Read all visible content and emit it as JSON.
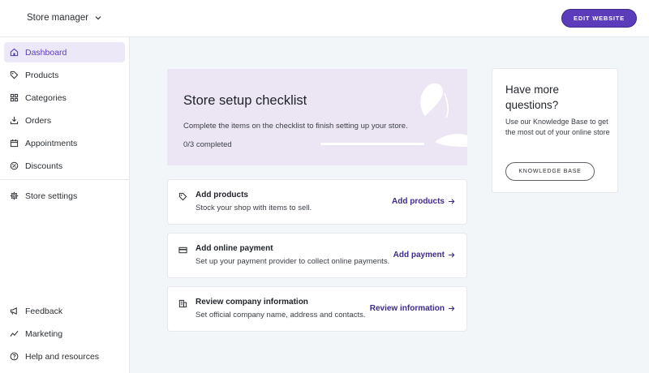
{
  "header": {
    "store_name": "Store manager",
    "edit_label": "EDIT WEBSITE"
  },
  "sidebar": {
    "items": [
      {
        "label": "Dashboard",
        "icon": "home-icon",
        "active": true
      },
      {
        "label": "Products",
        "icon": "tag-icon"
      },
      {
        "label": "Categories",
        "icon": "grid-icon"
      },
      {
        "label": "Orders",
        "icon": "download-tray-icon"
      },
      {
        "label": "Appointments",
        "icon": "calendar-icon"
      },
      {
        "label": "Discounts",
        "icon": "discount-icon"
      },
      {
        "label": "Store settings",
        "icon": "gear-icon"
      }
    ],
    "footer_items": [
      {
        "label": "Feedback",
        "icon": "megaphone-icon"
      },
      {
        "label": "Marketing",
        "icon": "trend-icon"
      },
      {
        "label": "Help and resources",
        "icon": "help-icon"
      }
    ]
  },
  "checklist": {
    "title": "Store setup checklist",
    "description": "Complete the items on the checklist to finish setting up your store.",
    "progress_text": "0/3 completed",
    "progress_fraction": 0,
    "tasks": [
      {
        "title": "Add products",
        "description": "Stock your shop with items to sell.",
        "link": "Add products",
        "icon": "tag-icon"
      },
      {
        "title": "Add online payment",
        "description": "Set up your payment provider to collect online payments.",
        "link": "Add payment",
        "icon": "card-icon"
      },
      {
        "title": "Review company information",
        "description": "Set official company name, address and contacts.",
        "link": "Review information",
        "icon": "building-icon"
      }
    ]
  },
  "help": {
    "title": "Have more questions?",
    "description": "Use our Knowledge Base to get the most out of your online store",
    "button_label": "KNOWLEDGE BASE"
  },
  "colors": {
    "accent": "#5b3dbb",
    "active_bg": "#ece8f7",
    "hero_bg": "#ece6f4",
    "page_bg": "#f3f6f9"
  }
}
